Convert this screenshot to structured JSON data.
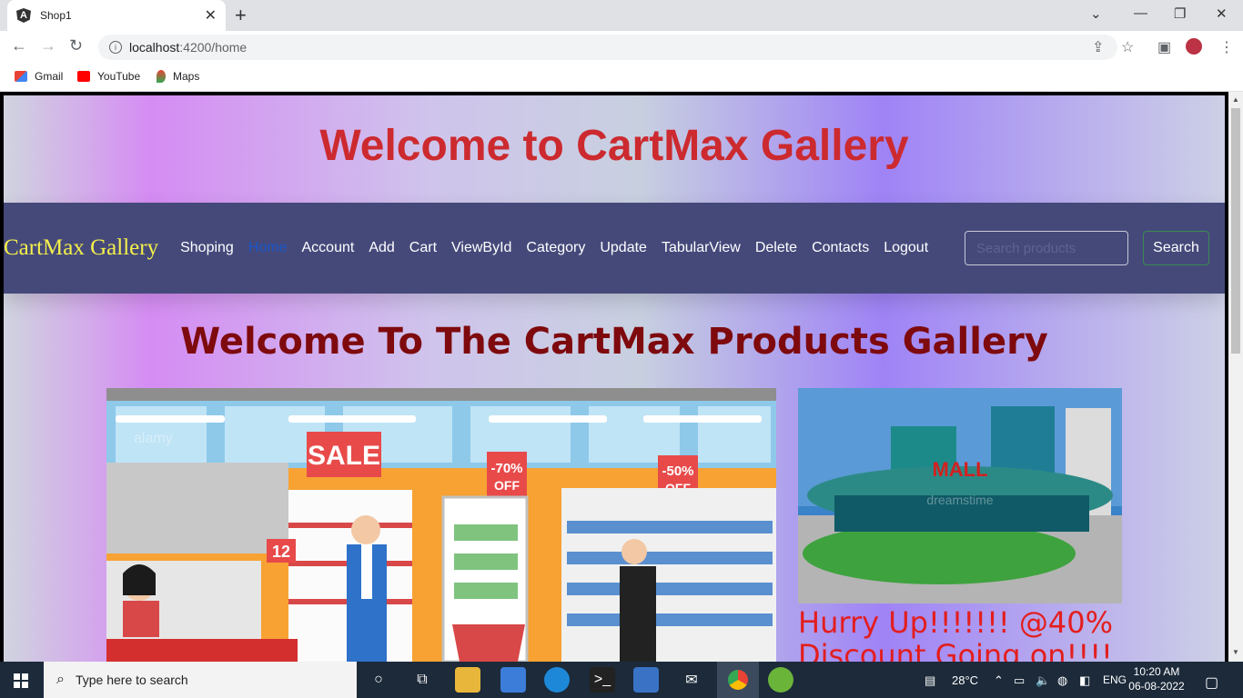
{
  "browser": {
    "tab_title": "Shop1",
    "url_host": "localhost",
    "url_rest": ":4200/home",
    "bookmarks": [
      {
        "label": "Gmail"
      },
      {
        "label": "YouTube"
      },
      {
        "label": "Maps"
      }
    ]
  },
  "page": {
    "hero_title": "Welcome to CartMax Gallery",
    "brand": "CartMax Gallery",
    "nav_links": [
      "Shoping",
      "Home",
      "Account",
      "Add",
      "Cart",
      "ViewById",
      "Category",
      "Update",
      "TabularView",
      "Delete",
      "Contacts",
      "Logout"
    ],
    "active_link": "Home",
    "search_placeholder": "Search products",
    "search_button": "Search",
    "sub_title": "Welcome To The CartMax Products Gallery",
    "store_image": {
      "sale_label": "SALE",
      "discount_1": "-70%",
      "discount_1_off": "OFF",
      "discount_2": "-50%",
      "discount_2_off": "OFF",
      "shelf_number": "12",
      "watermark": "alamy"
    },
    "mall_image": {
      "sign": "MALL",
      "watermark": "dreamstime"
    },
    "promo_line1": "Hurry Up!!!!!!! @40%",
    "promo_line2": "Discount Going on!!!!"
  },
  "taskbar": {
    "search_placeholder": "Type here to search",
    "temperature": "28°C",
    "language": "ENG",
    "time": "10:20 AM",
    "date": "06-08-2022"
  },
  "colors": {
    "hero_title": "#cc2a2f",
    "navbar_bg": "#45497a",
    "brand": "#f4f04a",
    "active_link": "#1a57c9",
    "sub_title": "#7e0a0e",
    "promo": "#e31e1e",
    "taskbar_bg": "#1c2a3a"
  }
}
